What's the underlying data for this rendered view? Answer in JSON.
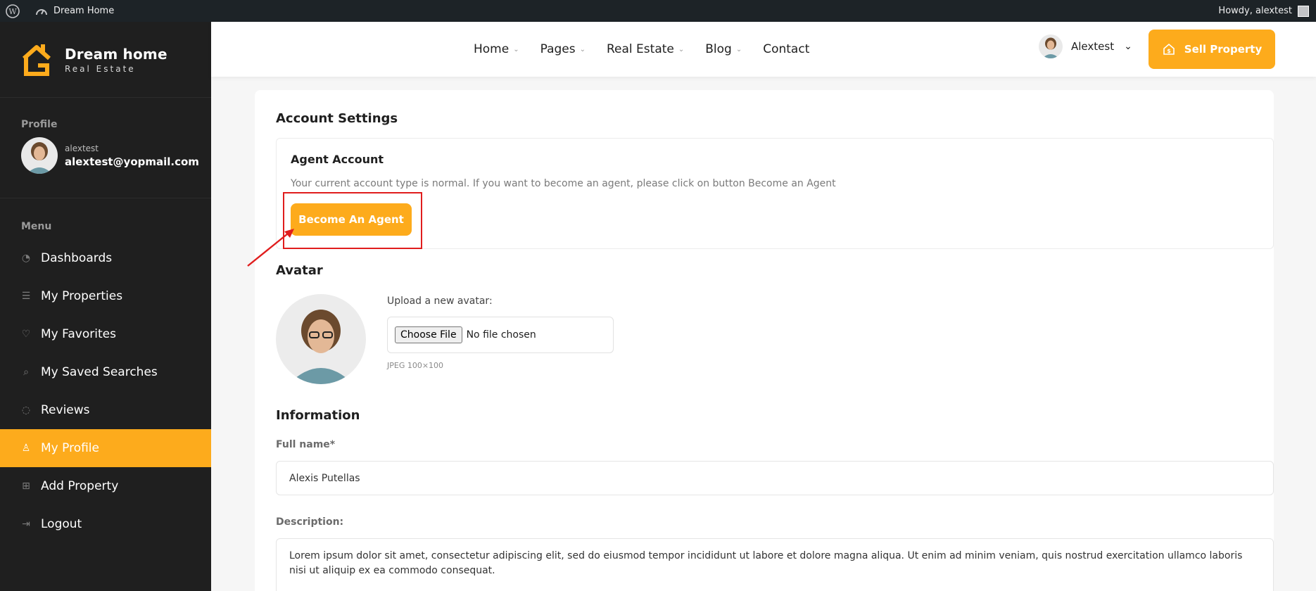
{
  "adminbar": {
    "site_title": "Dream Home",
    "howdy": "Howdy, alextest"
  },
  "brand": {
    "name": "Dream home",
    "tagline": "Real Estate",
    "accent": "#fdab1c"
  },
  "profile": {
    "heading": "Profile",
    "username": "alextest",
    "email": "alextest@yopmail.com"
  },
  "menu": {
    "heading": "Menu",
    "items": [
      {
        "label": "Dashboards",
        "icon": "dashboard-icon"
      },
      {
        "label": "My Properties",
        "icon": "list-icon"
      },
      {
        "label": "My Favorites",
        "icon": "heart-icon"
      },
      {
        "label": "My Saved Searches",
        "icon": "search-icon"
      },
      {
        "label": "Reviews",
        "icon": "chat-icon"
      },
      {
        "label": "My Profile",
        "icon": "user-icon",
        "active": true
      },
      {
        "label": "Add Property",
        "icon": "plus-square-icon"
      },
      {
        "label": "Logout",
        "icon": "logout-icon"
      }
    ]
  },
  "nav": {
    "items": [
      "Home",
      "Pages",
      "Real Estate",
      "Blog",
      "Contact"
    ]
  },
  "header": {
    "user": "Alextest",
    "sell_label": "Sell Property"
  },
  "account": {
    "title": "Account Settings",
    "agent_title": "Agent Account",
    "agent_desc": "Your current account type is normal. If you want to become an agent, please click on button Become an Agent",
    "agent_button": "Become An Agent"
  },
  "avatar": {
    "title": "Avatar",
    "upload_label": "Upload a new avatar:",
    "choose_label": "Choose File",
    "no_file": "No file chosen",
    "hint": "JPEG 100×100"
  },
  "information": {
    "title": "Information",
    "fullname_label": "Full name*",
    "fullname_value": "Alexis Putellas",
    "description_label": "Description:",
    "description_value": "Lorem ipsum dolor sit amet, consectetur adipiscing elit, sed do eiusmod tempor incididunt ut labore et dolore magna aliqua. Ut enim ad minim veniam, quis nostrud exercitation ullamco laboris nisi ut aliquip ex ea commodo consequat."
  }
}
